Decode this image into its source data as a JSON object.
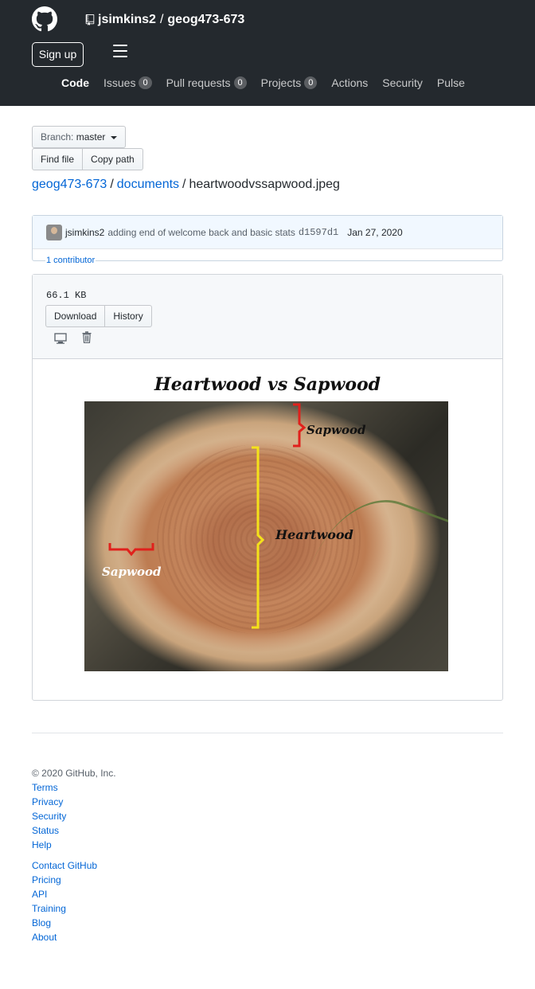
{
  "header": {
    "owner": "jsimkins2",
    "repo": "geog473-673",
    "signup_label": "Sign up",
    "nav": [
      {
        "label": "Code",
        "count": null
      },
      {
        "label": "Issues",
        "count": "0"
      },
      {
        "label": "Pull requests",
        "count": "0"
      },
      {
        "label": "Projects",
        "count": "0"
      },
      {
        "label": "Actions",
        "count": null
      },
      {
        "label": "Security",
        "count": null
      },
      {
        "label": "Pulse",
        "count": null
      }
    ]
  },
  "branch": {
    "label": "Branch:",
    "value": "master"
  },
  "file_actions": {
    "find_file": "Find file",
    "copy_path": "Copy path"
  },
  "breadcrumb": {
    "repo": "geog473-673",
    "folder": "documents",
    "file": "heartwoodvssapwood.jpeg"
  },
  "commit": {
    "author": "jsimkins2",
    "message": "adding end of welcome back and basic stats",
    "sha": "d1597d1",
    "date": "Jan 27, 2020",
    "contributors": "1 contributor"
  },
  "file": {
    "size": "66.1 KB",
    "download": "Download",
    "history": "History"
  },
  "image": {
    "title": "Heartwood vs Sapwood",
    "label_sapwood_top": "Sapwood",
    "label_heartwood": "Heartwood",
    "label_sapwood_left": "Sapwood",
    "colors": {
      "brace_red": "#e0211c",
      "brace_yellow": "#f5e21a"
    }
  },
  "footer": {
    "copyright": "© 2020 GitHub, Inc.",
    "links_1": [
      "Terms",
      "Privacy",
      "Security",
      "Status",
      "Help"
    ],
    "links_2": [
      "Contact GitHub",
      "Pricing",
      "API",
      "Training",
      "Blog",
      "About"
    ]
  }
}
